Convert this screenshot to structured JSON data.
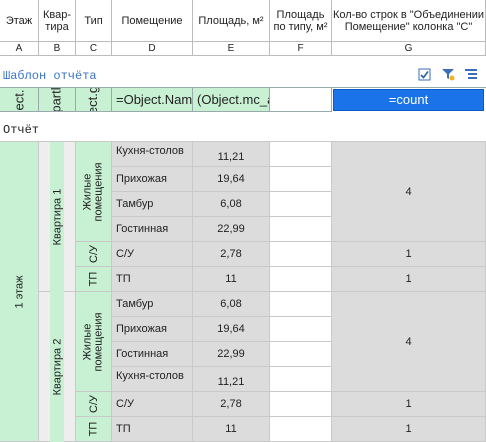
{
  "header": {
    "cols": [
      {
        "title": "Этаж",
        "letter": "A"
      },
      {
        "title": "Квар-\nтира",
        "letter": "B"
      },
      {
        "title": "Тип",
        "letter": "C"
      },
      {
        "title": "Помещение",
        "letter": "D"
      },
      {
        "title": "Площадь, м²",
        "letter": "E"
      },
      {
        "title": "Площадь по типу, м²",
        "letter": "F"
      },
      {
        "title": "Кол-во строк в \"Объединении Помещение\" колонка \"С\"",
        "letter": "G"
      }
    ]
  },
  "template": {
    "title": "Шаблон отчёта",
    "cells": {
      "a": "ect.",
      "b": "partl",
      "c": "ect.g",
      "d": "=Object.Nam",
      "e": "(Object.mc_a",
      "f": "",
      "g": "=count"
    },
    "icons": [
      "checkbox-icon",
      "filter-icon",
      "tree-icon"
    ]
  },
  "report": {
    "title": "Отчёт",
    "floor": "1 этаж",
    "apartments": [
      {
        "name": "Квартира 1",
        "groups": [
          {
            "type": "Жилые помещения",
            "count": "4",
            "rows": [
              {
                "room": "Кухня-столов",
                "area": "11,21"
              },
              {
                "room": "Прихожая",
                "area": "19,64"
              },
              {
                "room": "Тамбур",
                "area": "6,08"
              },
              {
                "room": "Гостинная",
                "area": "22,99"
              }
            ]
          },
          {
            "type": "С/У",
            "count": "1",
            "rows": [
              {
                "room": "С/У",
                "area": "2,78"
              }
            ]
          },
          {
            "type": "ТП",
            "count": "1",
            "rows": [
              {
                "room": "ТП",
                "area": "11"
              }
            ]
          }
        ]
      },
      {
        "name": "Квартира 2",
        "groups": [
          {
            "type": "Жилые помещения",
            "count": "4",
            "rows": [
              {
                "room": "Тамбур",
                "area": "6,08"
              },
              {
                "room": "Прихожая",
                "area": "19,64"
              },
              {
                "room": "Гостинная",
                "area": "22,99"
              },
              {
                "room": "Кухня-столов",
                "area": "11,21"
              }
            ]
          },
          {
            "type": "С/У",
            "count": "1",
            "rows": [
              {
                "room": "С/У",
                "area": "2,78"
              }
            ]
          },
          {
            "type": "ТП",
            "count": "1",
            "rows": [
              {
                "room": "ТП",
                "area": "11"
              }
            ]
          }
        ]
      }
    ]
  }
}
